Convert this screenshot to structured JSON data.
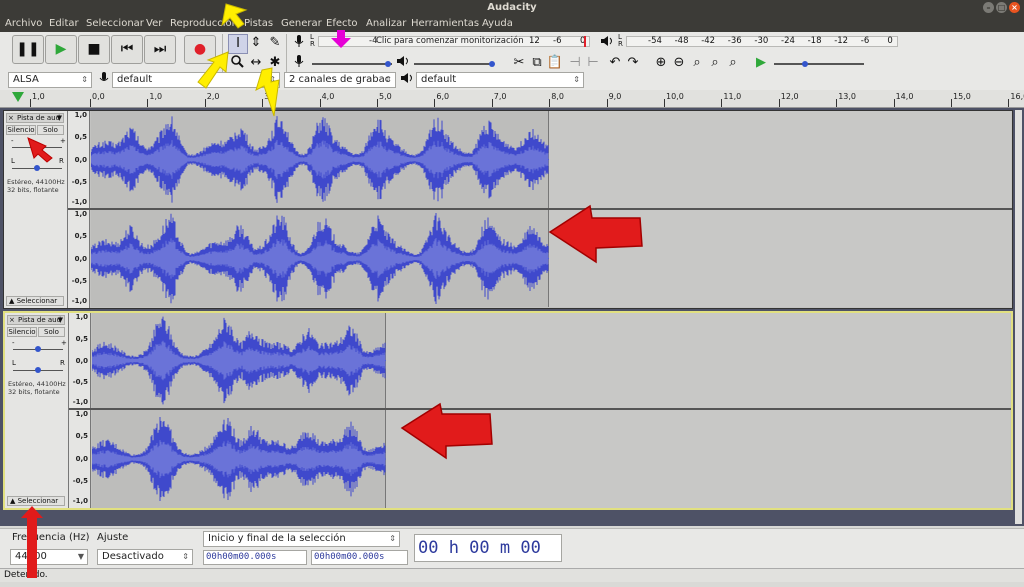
{
  "window": {
    "title": "Audacity",
    "min": "–",
    "max": "□",
    "close": "×"
  },
  "menu": [
    "Archivo",
    "Editar",
    "Seleccionar",
    "Ver",
    "Reproducción",
    "Pistas",
    "Generar",
    "Efecto",
    "Analizar",
    "Herramientas",
    "Ayuda"
  ],
  "transport": {
    "pause": "❚❚",
    "play": "▶",
    "stop": "■",
    "skip_start": "⏮",
    "skip_end": "⏭",
    "record": "●"
  },
  "tools": {
    "select": "I",
    "envelope": "⇕",
    "draw": "✎",
    "zoom": "🔍",
    "timeshift": "↔",
    "multi": "✱"
  },
  "recording_meter": {
    "icon": "mic-icon",
    "lr": "L\nR",
    "hint": "Clic para comenzar monitorización",
    "scale_shown": [
      "-4",
      "12",
      "-6",
      "0"
    ]
  },
  "playback_meter": {
    "icon": "speaker-icon",
    "scale": [
      "-54",
      "-48",
      "-42",
      "-36",
      "-30",
      "-24",
      "-18",
      "-12",
      "-6",
      "0"
    ]
  },
  "device_bar": {
    "host": "ALSA",
    "rec_device": "default",
    "channels": "2 canales de grabac",
    "play_device": "default"
  },
  "ruler": {
    "ticks": [
      "1,0",
      "0,0",
      "1,0",
      "2,0",
      "3,0",
      "4,0",
      "5,0",
      "6,0",
      "7,0",
      "8,0",
      "9,0",
      "10,0",
      "11,0",
      "12,0",
      "13,0",
      "14,0",
      "15,0",
      "16,0"
    ]
  },
  "tracks": [
    {
      "name": "Pista de aud",
      "mute": "Silencio",
      "solo": "Solo",
      "info1": "Estéreo, 44100Hz",
      "info2": "32 bits, flotante",
      "select": "Seleccionar",
      "gain_minus": "-",
      "gain_plus": "+",
      "pan_l": "L",
      "pan_r": "R",
      "close": "×",
      "menu": "▼"
    },
    {
      "name": "Pista de aud",
      "mute": "Silencio",
      "solo": "Solo",
      "info1": "Estéreo, 44100Hz",
      "info2": "32 bits, flotante",
      "select": "Seleccionar",
      "gain_minus": "-",
      "gain_plus": "+",
      "pan_l": "L",
      "pan_r": "R",
      "close": "×",
      "menu": "▼"
    }
  ],
  "vruler_labels": [
    "1,0",
    "0,5",
    "0,0",
    "-0,5",
    "-1,0"
  ],
  "bottom": {
    "rate_label": "Frecuencia (Hz)",
    "rate_value": "44100",
    "snap_label": "Ajuste",
    "snap_value": "Desactivado",
    "selection_mode": "Inicio y final de la selección",
    "sel_start": "00h00m00.000s",
    "sel_end": "00h00m00.000s",
    "time_display": "00 h 00 m 00 s"
  },
  "status": "Detenido.",
  "colors": {
    "waveform": "#3f49cc",
    "waveform_light": "#6a73d8",
    "annotation_red": "#e11b1b",
    "annotation_yellow": "#ffee00",
    "annotation_magenta": "#e600d6",
    "selected_track_border": "#e1e080"
  }
}
